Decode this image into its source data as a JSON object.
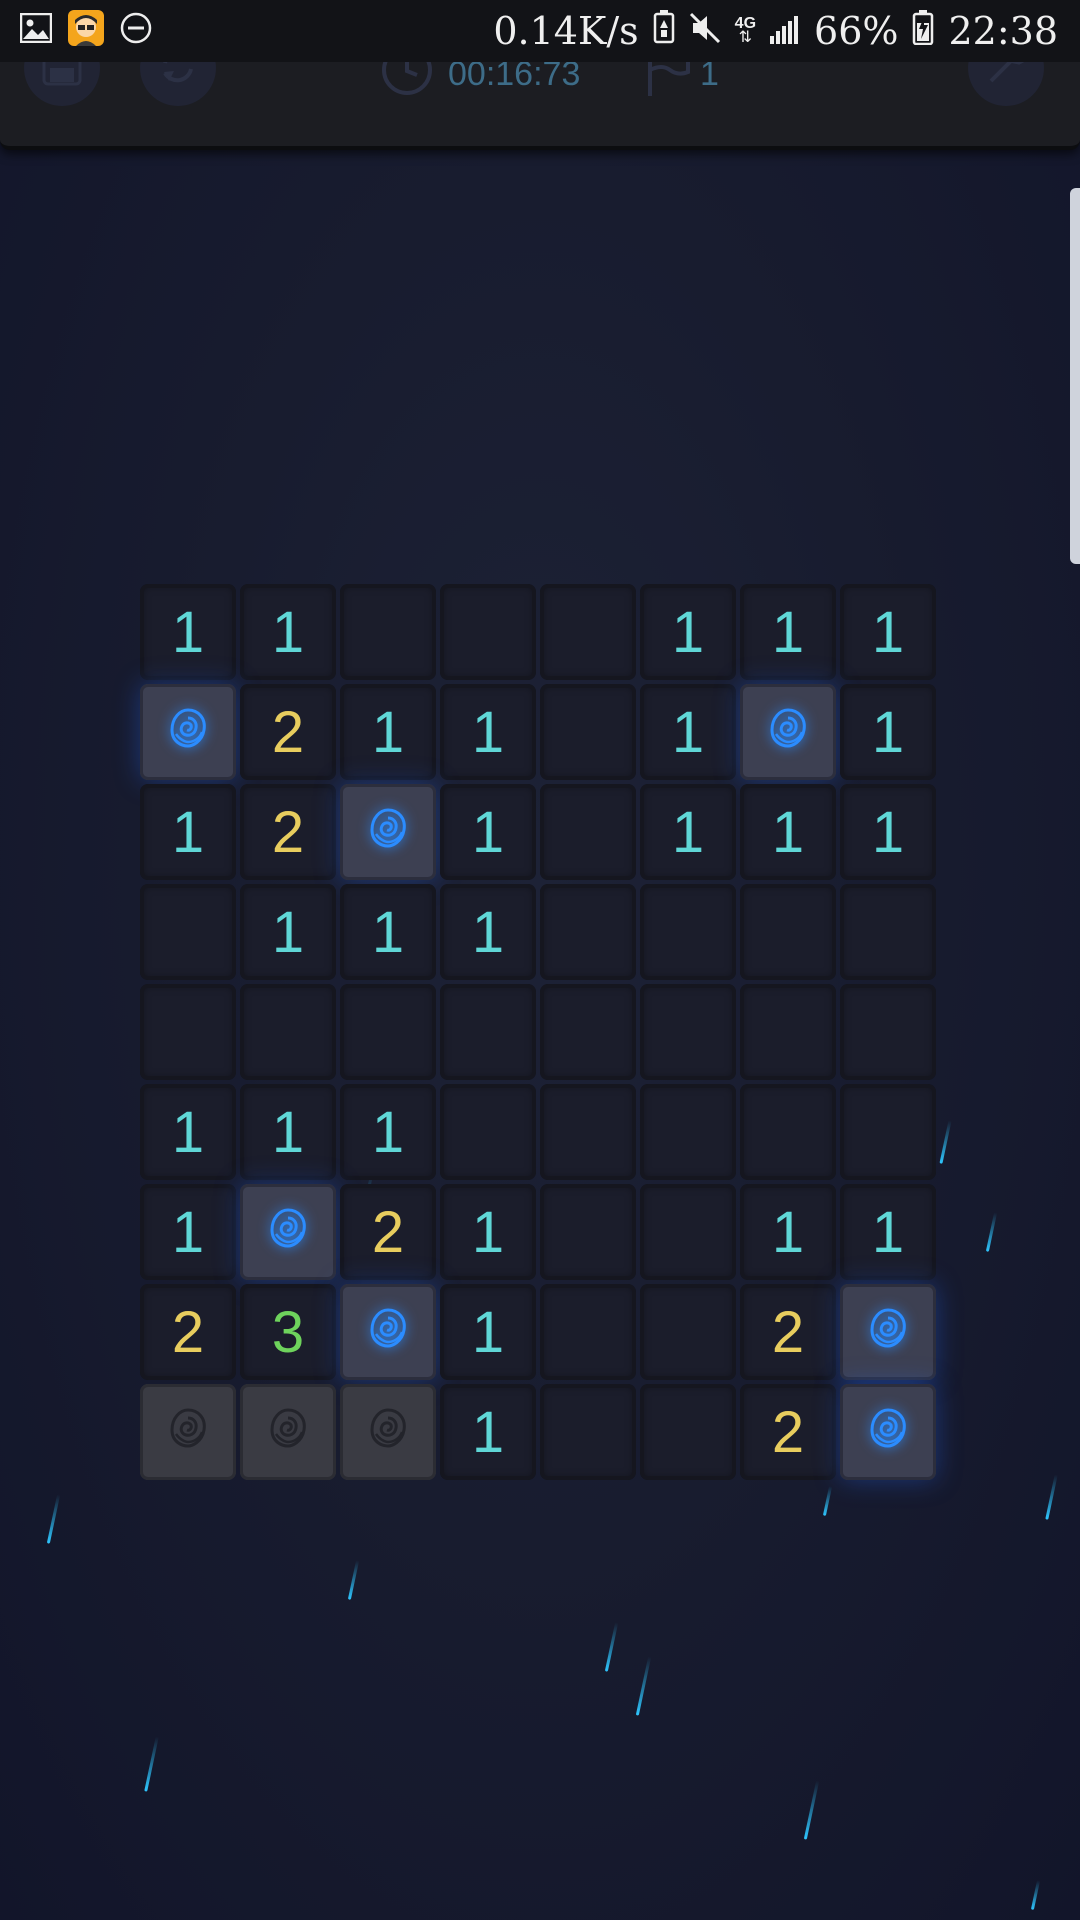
{
  "status_bar": {
    "net_speed": "0.14K/s",
    "network": "4G",
    "battery": "66%",
    "time": "22:38"
  },
  "toolbar": {
    "timer": "00:16:73",
    "flags": "1"
  },
  "board": {
    "rows": 9,
    "cols": 8,
    "cells": [
      [
        "1",
        "1",
        "",
        "",
        "",
        "1",
        "1",
        "1"
      ],
      [
        "M",
        "2",
        "1",
        "1",
        "",
        "1",
        "M",
        "1"
      ],
      [
        "1",
        "2",
        "M",
        "1",
        "",
        "1",
        "1",
        "1"
      ],
      [
        "",
        "1",
        "1",
        "1",
        "",
        "",
        "",
        ""
      ],
      [
        "",
        "",
        "",
        "",
        "",
        "",
        "",
        ""
      ],
      [
        "1",
        "1",
        "1",
        "",
        "",
        "",
        "",
        ""
      ],
      [
        "1",
        "M",
        "2",
        "1",
        "",
        "",
        "1",
        "1"
      ],
      [
        "2",
        "3",
        "M",
        "1",
        "",
        "",
        "2",
        "M"
      ],
      [
        "X",
        "X",
        "X",
        "1",
        "",
        "",
        "2",
        "M"
      ]
    ]
  },
  "colors": {
    "one": "#5fd6d6",
    "two": "#e8cd5e",
    "three": "#6ed35c",
    "mine_glow": "#2b8cff"
  }
}
